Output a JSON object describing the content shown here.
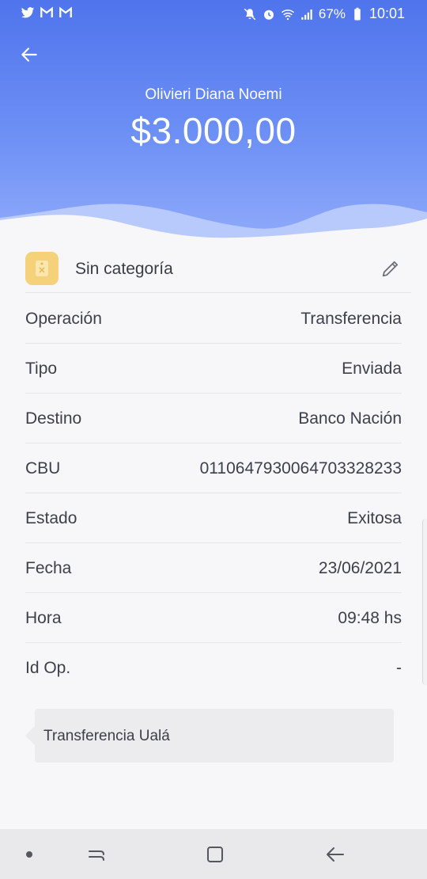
{
  "statusbar": {
    "battery": "67%",
    "time": "10:01",
    "left_icons": [
      "twitter-icon",
      "gmail-icon",
      "gmail-icon"
    ],
    "right_icons": [
      "mute-icon",
      "alarm-icon",
      "wifi-icon",
      "signal-icon",
      "battery-icon"
    ]
  },
  "header": {
    "recipient": "Olivieri Diana Noemi",
    "amount": "$3.000,00",
    "gradient_top": "#4f74ec",
    "gradient_bottom": "#8ea9fa"
  },
  "category": {
    "label": "Sin categoría",
    "icon": "tag-icon",
    "icon_color": "#f5d27a"
  },
  "details": [
    {
      "label": "Operación",
      "value": "Transferencia"
    },
    {
      "label": "Tipo",
      "value": "Enviada"
    },
    {
      "label": "Destino",
      "value": "Banco Nación"
    },
    {
      "label": "CBU",
      "value": "0110647930064703328233"
    },
    {
      "label": "Estado",
      "value": "Exitosa"
    },
    {
      "label": "Fecha",
      "value": "23/06/2021"
    },
    {
      "label": "Hora",
      "value": "09:48 hs"
    },
    {
      "label": "Id Op.",
      "value": "-"
    }
  ],
  "note": {
    "text": "Transferencia Ualá"
  },
  "navbar": {
    "buttons": [
      "dot-icon",
      "recent-apps-icon",
      "home-icon",
      "back-icon"
    ]
  }
}
